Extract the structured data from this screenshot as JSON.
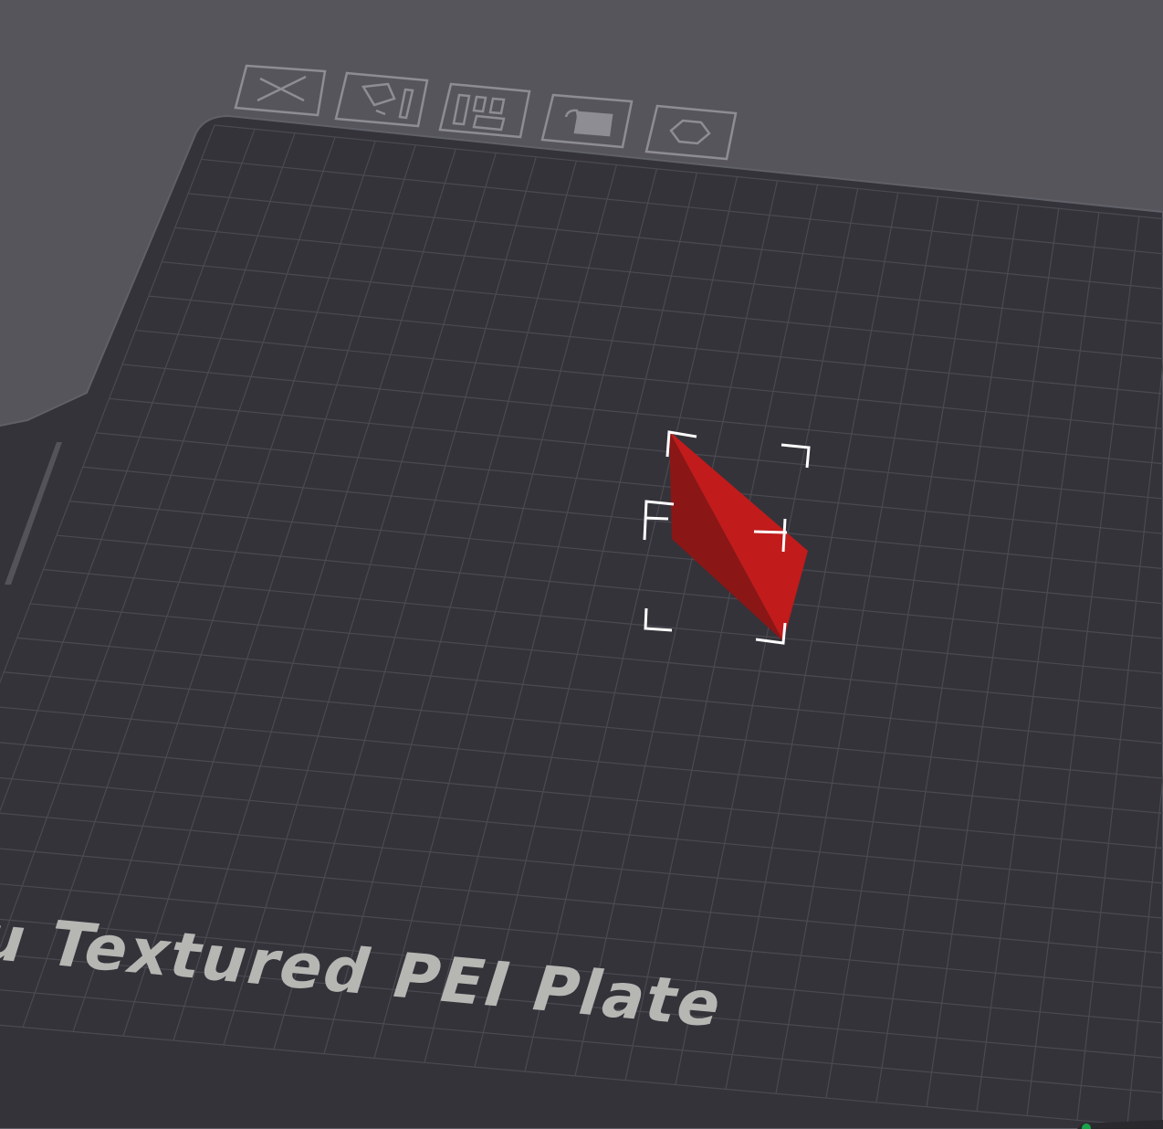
{
  "viewport": {
    "background": "#56555b",
    "plate_color": "#34333a",
    "grid_color": "#4a4950",
    "model_color": "#c11b1b"
  },
  "plate": {
    "label": "Bambu Textured PEI Plate"
  },
  "plate_toolbar": {
    "icons": [
      "close-plate-icon",
      "auto-orient-icon",
      "arrange-icon",
      "lock-icon",
      "settings-hex-icon"
    ]
  }
}
